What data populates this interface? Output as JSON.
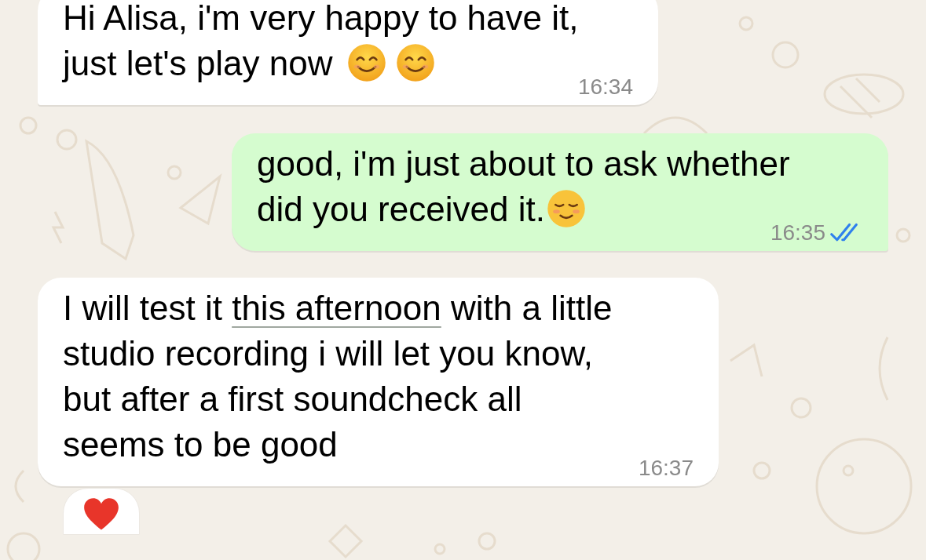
{
  "messages": [
    {
      "kind": "incoming",
      "parts": [
        {
          "kind": "text",
          "text": "Hi Alisa, i'm very happy to have it, just let's play now "
        },
        {
          "kind": "emoji"
        },
        {
          "kind": "emoji"
        }
      ],
      "time": "16:34"
    },
    {
      "kind": "outgoing",
      "parts": [
        {
          "kind": "text",
          "text": "good, i'm just about to ask whether did you received it."
        },
        {
          "kind": "emoji"
        }
      ],
      "time": "16:35",
      "read": true
    },
    {
      "kind": "incoming",
      "parts": [
        {
          "kind": "text",
          "text": "I will test it "
        },
        {
          "kind": "link",
          "text": "this afternoon"
        },
        {
          "kind": "text",
          "text": " with a little studio recording i will let you know, but after a first soundcheck all seems to be good"
        }
      ],
      "time": "16:37",
      "reaction": {
        "kind": "heart"
      }
    }
  ]
}
